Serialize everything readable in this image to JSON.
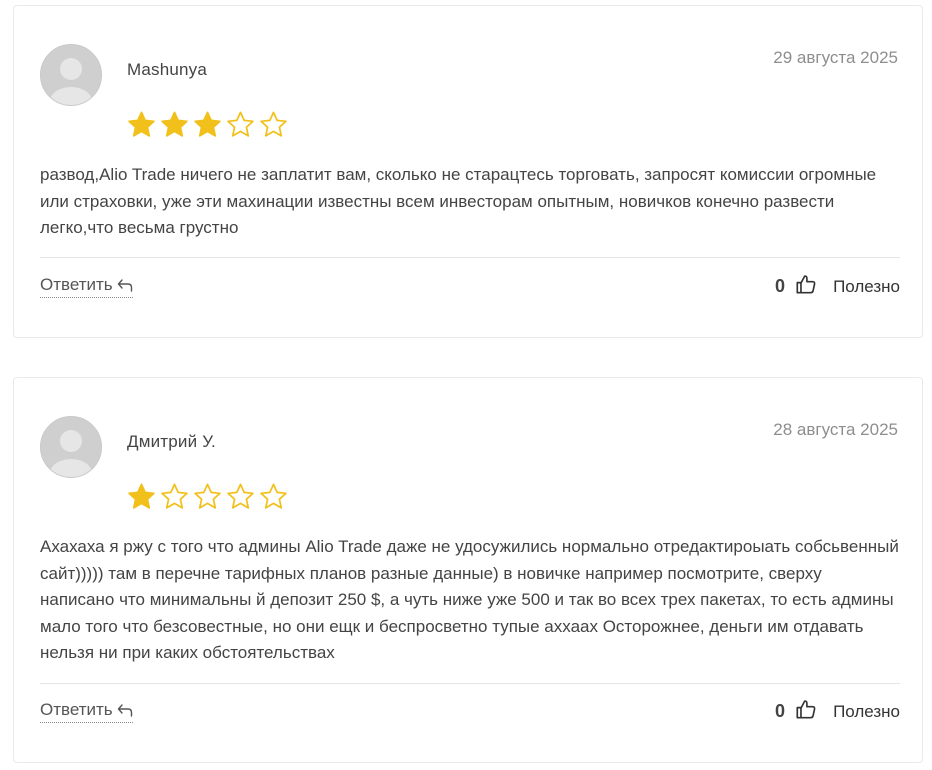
{
  "colors": {
    "star_filled": "#f2c01b",
    "star_outline": "#f2c01b",
    "avatar_bg": "#cfcfcf",
    "date_text": "#8e8e8e"
  },
  "reviews": [
    {
      "author": "Mashunya",
      "date": "29 августа 2025",
      "rating": 3,
      "max_rating": 5,
      "text": "развод,Alio Trade ничего не заплатит вам, сколько не старацтесь торговать, запросят комиссии огромные или страховки, уже эти махинации известны всем инвесторам опытным, новичков конечно развести легко,что весьма грустно",
      "reply_label": "Ответить",
      "helpful_count": "0",
      "helpful_label": "Полезно"
    },
    {
      "author": "Дмитрий У.",
      "date": "28 августа 2025",
      "rating": 1,
      "max_rating": 5,
      "text": "Ахахаха я ржу с того что админы Alio Trade даже не удосужились нормально отредактироыать собсьвенный сайт))))) там в перечне тарифных планов разные данные) в новичке например посмотрите, сверху написано что минимальны й депозит 250 $, а чуть ниже уже 500 и так во всех трех пакетах, то есть админы мало того что безсовестные, но они ещк и беспросветно тупые аххаах Осторожнее, деньги им отдавать нельзя ни при каких обстоятельствах",
      "reply_label": "Ответить",
      "helpful_count": "0",
      "helpful_label": "Полезно"
    }
  ],
  "icons": {
    "avatar": "user-silhouette-icon",
    "star": "star-icon",
    "reply": "reply-arrow-icon",
    "like": "thumbs-up-icon"
  }
}
